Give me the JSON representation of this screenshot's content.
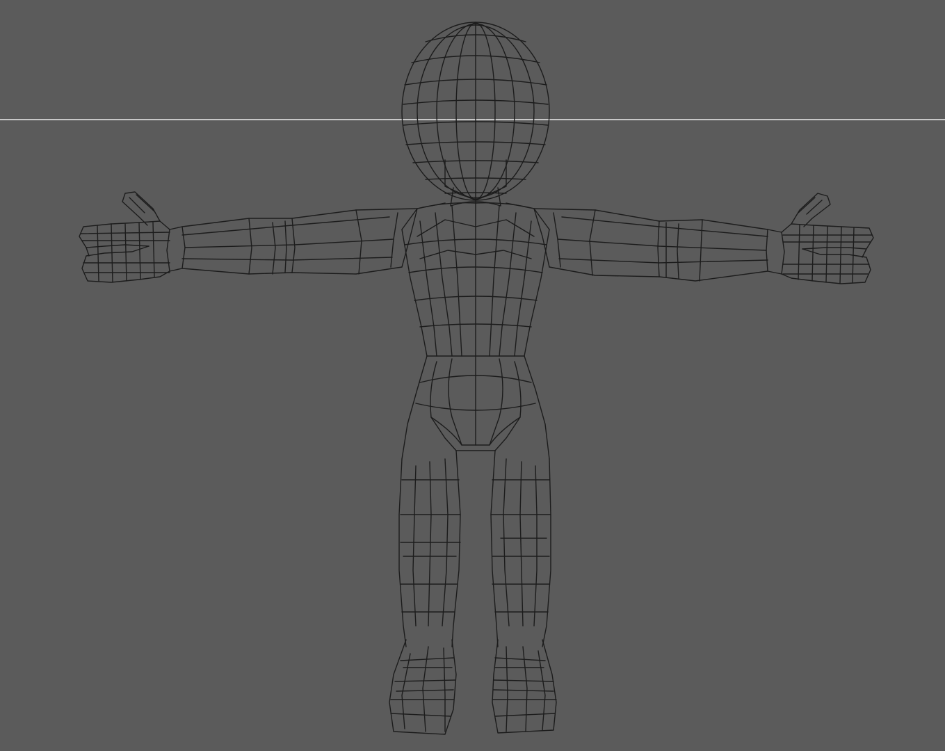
{
  "viewport": {
    "background_color": "#5b5b5b",
    "wire_color": "#1c1c1c",
    "grid_line_color": "#c8c8c8",
    "display_mode": "wireframe",
    "view": "front",
    "grid_visible": true,
    "model_pose": "T-pose"
  }
}
